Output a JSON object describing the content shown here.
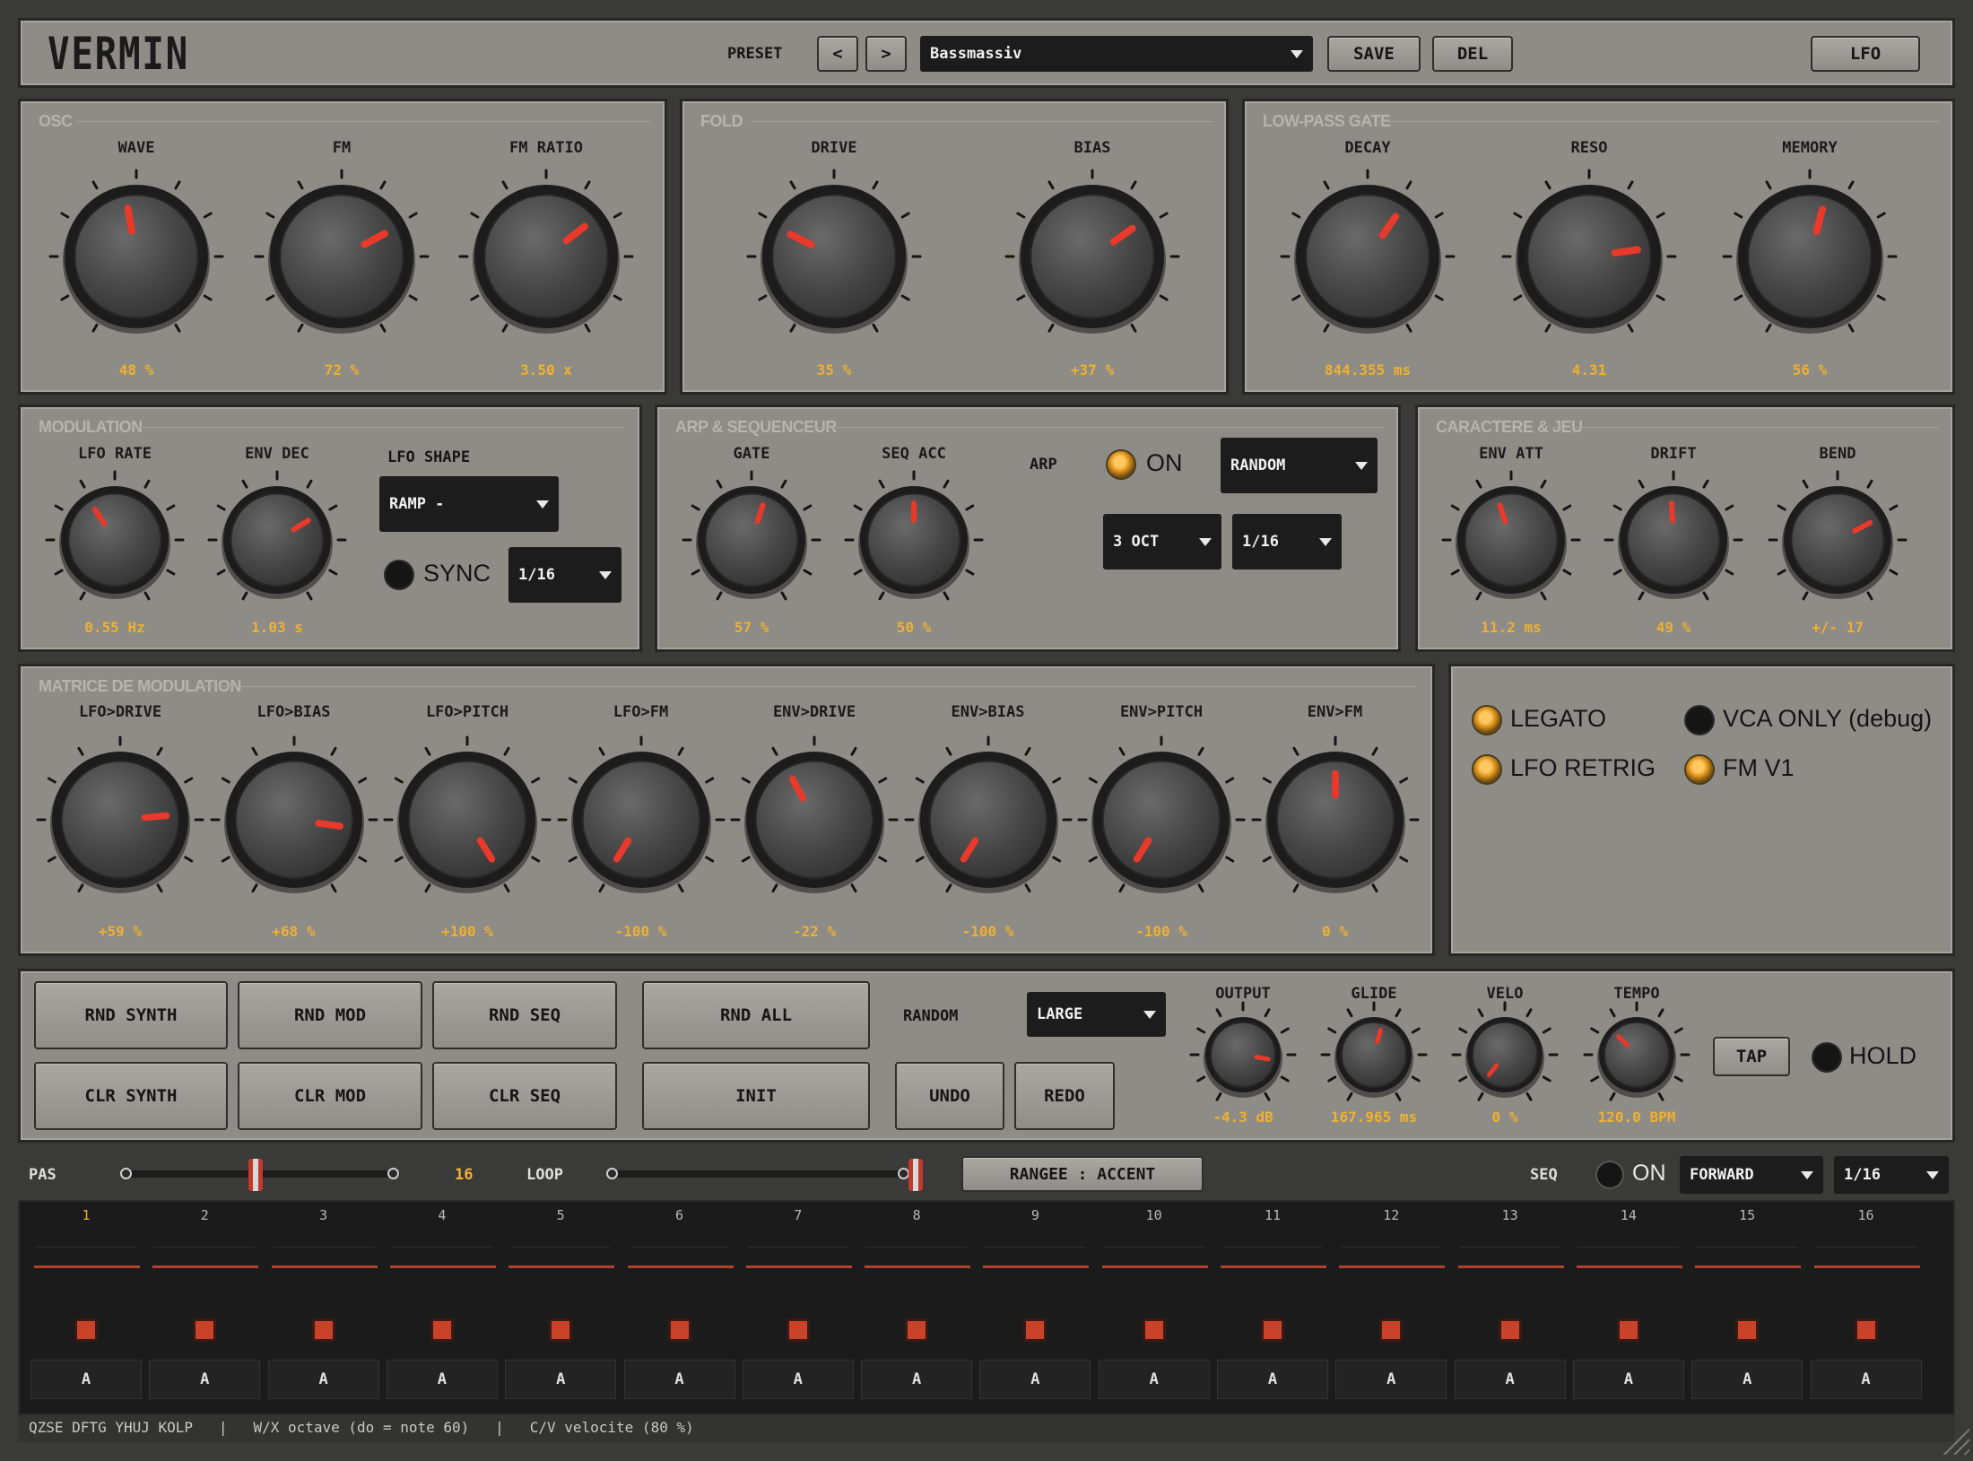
{
  "header": {
    "logo": "VERMIN",
    "preset_label": "PRESET",
    "prev_label": "<",
    "next_label": ">",
    "preset_value": "Bassmassiv",
    "save_label": "SAVE",
    "del_label": "DEL",
    "lfo_label": "LFO"
  },
  "osc": {
    "title": "OSC",
    "knobs": [
      {
        "label": "WAVE",
        "value": "48 %"
      },
      {
        "label": "FM",
        "value": "72 %"
      },
      {
        "label": "FM RATIO",
        "value": "3.50 x"
      }
    ]
  },
  "fold": {
    "title": "FOLD",
    "knobs": [
      {
        "label": "DRIVE",
        "value": "35 %"
      },
      {
        "label": "BIAS",
        "value": "+37 %"
      }
    ]
  },
  "lpg": {
    "title": "LOW-PASS GATE",
    "knobs": [
      {
        "label": "DECAY",
        "value": "844.355 ms"
      },
      {
        "label": "RESO",
        "value": "4.31"
      },
      {
        "label": "MEMORY",
        "value": "56 %"
      }
    ]
  },
  "modulation": {
    "title": "MODULATION",
    "knobs": [
      {
        "label": "LFO RATE",
        "value": "0.55 Hz"
      },
      {
        "label": "ENV DEC",
        "value": "1.03 s"
      }
    ],
    "lfo_shape_label": "LFO SHAPE",
    "lfo_shape_value": "RAMP -",
    "sync_label": "SYNC",
    "sync_rate": "1/16"
  },
  "arp": {
    "title": "ARP & SEQUENCEUR",
    "knobs": [
      {
        "label": "GATE",
        "value": "57 %"
      },
      {
        "label": "SEQ ACC",
        "value": "50 %"
      }
    ],
    "arp_label": "ARP",
    "on_label": "ON",
    "mode_value": "RANDOM",
    "octave_value": "3 OCT",
    "rate_value": "1/16"
  },
  "caractere": {
    "title": "CARACTERE & JEU",
    "knobs": [
      {
        "label": "ENV ATT",
        "value": "11.2 ms"
      },
      {
        "label": "DRIFT",
        "value": "49 %"
      },
      {
        "label": "BEND",
        "value": "+/- 17"
      }
    ]
  },
  "matrix": {
    "title": "MATRICE DE MODULATION",
    "knobs": [
      {
        "label": "LFO>DRIVE",
        "value": "+59 %"
      },
      {
        "label": "LFO>BIAS",
        "value": "+68 %"
      },
      {
        "label": "LFO>PITCH",
        "value": "+100 %"
      },
      {
        "label": "LFO>FM",
        "value": "-100 %"
      },
      {
        "label": "ENV>DRIVE",
        "value": "-22 %"
      },
      {
        "label": "ENV>BIAS",
        "value": "-100 %"
      },
      {
        "label": "ENV>PITCH",
        "value": "-100 %"
      },
      {
        "label": "ENV>FM",
        "value": "0 %"
      }
    ]
  },
  "toggles": {
    "legato": "LEGATO",
    "vca_only": "VCA ONLY (debug)",
    "lfo_retrig": "LFO RETRIG",
    "fm_v1": "FM V1"
  },
  "actions": {
    "rnd_synth": "RND SYNTH",
    "rnd_mod": "RND MOD",
    "rnd_seq": "RND SEQ",
    "rnd_all": "RND ALL",
    "clr_synth": "CLR SYNTH",
    "clr_mod": "CLR MOD",
    "clr_seq": "CLR SEQ",
    "init": "INIT",
    "undo": "UNDO",
    "redo": "REDO",
    "random_label": "RANDOM",
    "random_value": "LARGE",
    "tap": "TAP",
    "hold": "HOLD"
  },
  "output_knobs": [
    {
      "label": "OUTPUT",
      "value": "-4.3 dB"
    },
    {
      "label": "GLIDE",
      "value": "167.965 ms"
    },
    {
      "label": "VELO",
      "value": "0 %"
    },
    {
      "label": "TEMPO",
      "value": "120.0 BPM"
    }
  ],
  "seqbar": {
    "pas_label": "PAS",
    "pas_value": "16",
    "loop_label": "LOOP",
    "range_button": "RANGEE : ACCENT",
    "seq_label": "SEQ",
    "on_label": "ON",
    "direction_value": "FORWARD",
    "rate_value": "1/16"
  },
  "steps": [
    {
      "num": "1",
      "acc": "A"
    },
    {
      "num": "2",
      "acc": "A"
    },
    {
      "num": "3",
      "acc": "A"
    },
    {
      "num": "4",
      "acc": "A"
    },
    {
      "num": "5",
      "acc": "A"
    },
    {
      "num": "6",
      "acc": "A"
    },
    {
      "num": "7",
      "acc": "A"
    },
    {
      "num": "8",
      "acc": "A"
    },
    {
      "num": "9",
      "acc": "A"
    },
    {
      "num": "10",
      "acc": "A"
    },
    {
      "num": "11",
      "acc": "A"
    },
    {
      "num": "12",
      "acc": "A"
    },
    {
      "num": "13",
      "acc": "A"
    },
    {
      "num": "14",
      "acc": "A"
    },
    {
      "num": "15",
      "acc": "A"
    },
    {
      "num": "16",
      "acc": "A"
    }
  ],
  "footer": "QZSE DFTG YHUJ KOLP   |   W/X octave (do = note 60)   |   C/V velocite (80 %)",
  "colors": {
    "panel": "#8e8c86",
    "accent": "#f0b030",
    "indicator": "#e8392a",
    "step": "#c9432b"
  }
}
